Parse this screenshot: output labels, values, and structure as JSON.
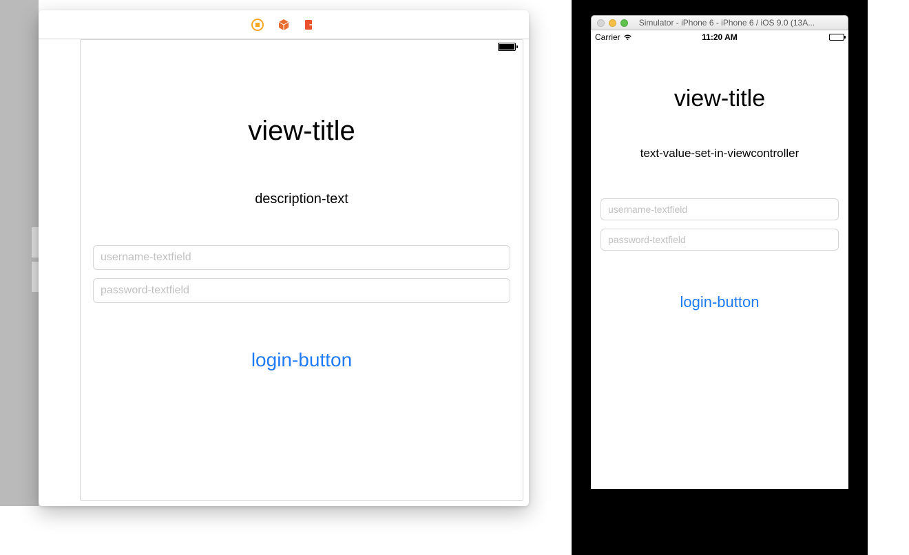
{
  "ib": {
    "title": "view-title",
    "description": "description-text",
    "username_placeholder": "username-textfield",
    "password_placeholder": "password-textfield",
    "login_label": "login-button",
    "toolbar_icons": {
      "stop": "stop-icon",
      "cube": "cube-icon",
      "exit": "exit-icon"
    }
  },
  "sim": {
    "window_title": "Simulator - iPhone 6 - iPhone 6 / iOS 9.0 (13A...",
    "status": {
      "carrier": "Carrier",
      "time": "11:20 AM"
    },
    "title": "view-title",
    "description": "text-value-set-in-viewcontroller",
    "username_placeholder": "username-textfield",
    "password_placeholder": "password-textfield",
    "login_label": "login-button"
  }
}
